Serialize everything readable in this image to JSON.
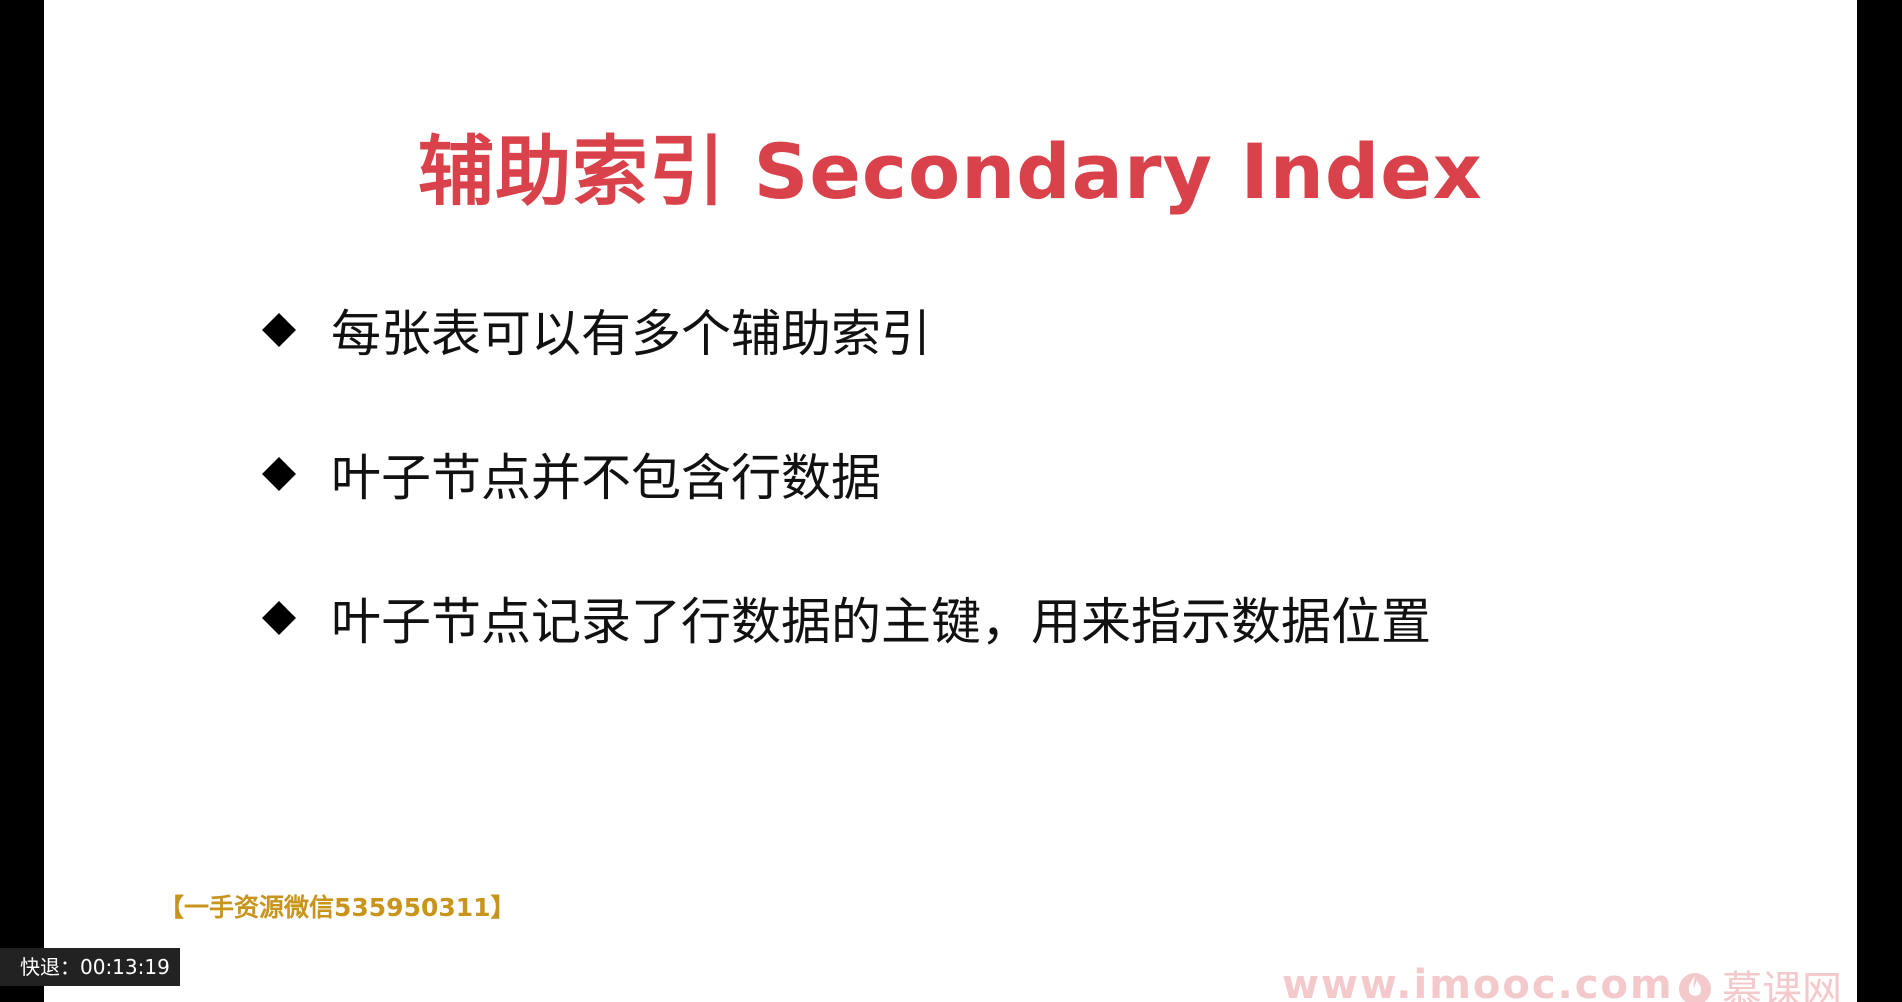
{
  "slide": {
    "title": "辅助索引 Secondary Index",
    "bullets": [
      "每张表可以有多个辅助索引",
      "叶子节点并不包含行数据",
      "叶子节点记录了行数据的主键，用来指示数据位置"
    ],
    "resource_note": "【一手资源微信535950311】",
    "title_color": "#d9424a",
    "bullet_icon": "diamond-icon"
  },
  "player": {
    "rewind_label": "快退：00:13:19"
  },
  "branding": {
    "url": "www.imooc.com",
    "logo_text": "慕课网",
    "logo_icon": "flame-icon"
  }
}
